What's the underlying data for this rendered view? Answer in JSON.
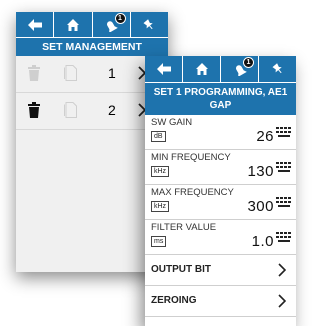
{
  "toolbar": {
    "buttons": [
      {
        "icon": "arrow-left-icon"
      },
      {
        "icon": "home-icon"
      },
      {
        "icon": "alarm-bell-icon",
        "badge": "1"
      },
      {
        "icon": "pin-icon"
      }
    ],
    "color": "#1e73ad"
  },
  "set_management": {
    "title": "SET MANAGEMENT",
    "rows": [
      {
        "number": "1"
      },
      {
        "number": "2"
      }
    ]
  },
  "set_programming": {
    "title_line1": "SET 1 PROGRAMMING, AE1",
    "title_line2": "GAP",
    "params": [
      {
        "label": "SW GAIN",
        "unit": "dB",
        "value": "26"
      },
      {
        "label": "MIN FREQUENCY",
        "unit": "kHz",
        "value": "130"
      },
      {
        "label": "MAX FREQUENCY",
        "unit": "kHz",
        "value": "300"
      },
      {
        "label": "FILTER VALUE",
        "unit": "ms",
        "value": "1.0"
      }
    ],
    "menu": [
      {
        "label": "OUTPUT BIT"
      },
      {
        "label": "ZEROING"
      }
    ]
  }
}
